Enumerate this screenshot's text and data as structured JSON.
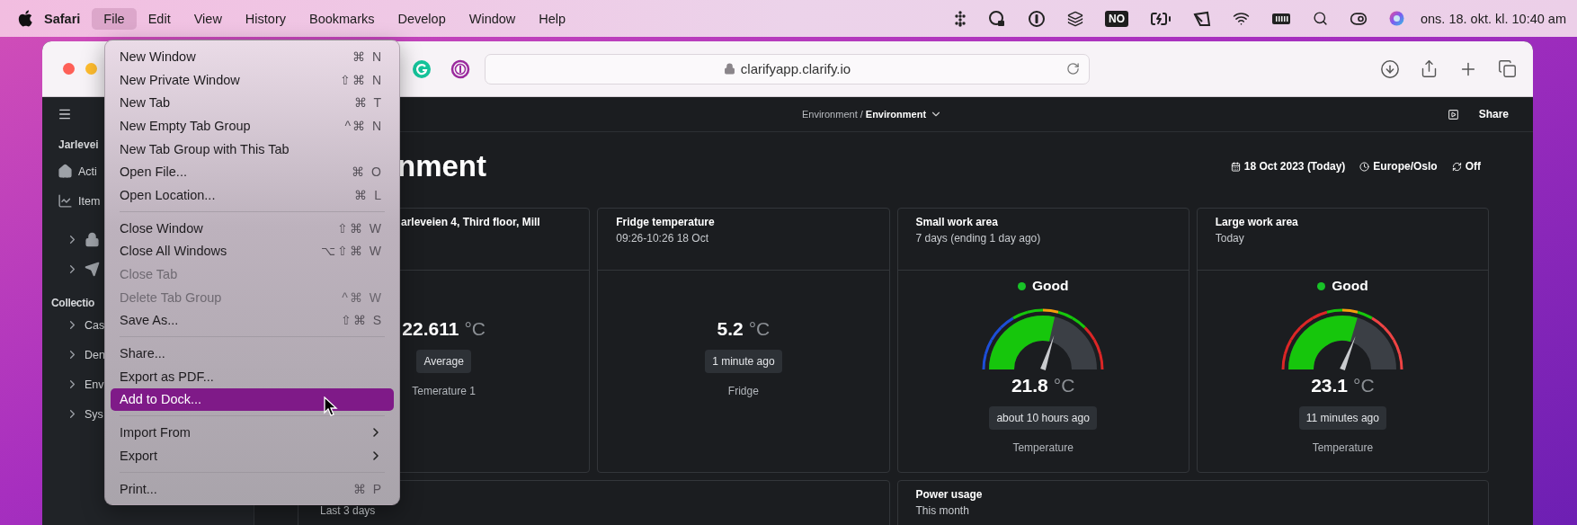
{
  "menubar": {
    "app": "Safari",
    "menus": [
      {
        "label": "File",
        "selected": true
      },
      {
        "label": "Edit",
        "selected": false
      },
      {
        "label": "View",
        "selected": false
      },
      {
        "label": "History",
        "selected": false
      },
      {
        "label": "Bookmarks",
        "selected": false
      },
      {
        "label": "Develop",
        "selected": false
      },
      {
        "label": "Window",
        "selected": false
      },
      {
        "label": "Help",
        "selected": false
      }
    ],
    "input_source": "NO",
    "clock": "ons. 18. okt. kl. 10:40 am"
  },
  "browser": {
    "url": "clarifyapp.clarify.io"
  },
  "sidebar": {
    "org": "Jarlevei",
    "nav": [
      {
        "label": "Acti"
      },
      {
        "label": "Item"
      }
    ],
    "pinned": [
      {
        "expanded": false
      },
      {
        "expanded": false
      }
    ],
    "section": "Collectio",
    "collections": [
      {
        "label": "Cas",
        "expanded": false
      },
      {
        "label": "Den",
        "expanded": false
      },
      {
        "label": "Env",
        "expanded": false
      },
      {
        "label": "Sys",
        "expanded": false
      }
    ]
  },
  "page": {
    "breadcrumb": {
      "parent": "Environment /",
      "current": "Environment"
    },
    "share": "Share",
    "title": "nment",
    "date": "18 Oct 2023 (Today)",
    "timezone": "Europe/Oslo",
    "refresh": "Off",
    "cards": [
      {
        "kind": "value",
        "title": "arleveien 4, Third floor, Mill",
        "value": "22.611",
        "unit": "°C",
        "tag": "Average",
        "caption": "Temerature 1"
      },
      {
        "kind": "value",
        "title": "Fridge temperature",
        "subtitle": "09:26-10:26 18 Oct",
        "value": "5.2",
        "unit": "°C",
        "tag": "1 minute ago",
        "caption": "Fridge"
      },
      {
        "kind": "gauge",
        "title": "Small work area",
        "subtitle": "7 days (ending 1 day ago)",
        "status": {
          "label": "Good",
          "color": "#18c227"
        },
        "gauge": {
          "level": 0.6,
          "zones": [
            {
              "color": "#1d4ed8"
            },
            {
              "color": "#1d4ed8"
            },
            {
              "color": "#1d4ed8"
            },
            {
              "color": "#1d4ed8"
            },
            {
              "color": "#16c60c"
            },
            {
              "color": "#16c60c"
            },
            {
              "color": "#f59e0b"
            },
            {
              "color": "#16c60c"
            },
            {
              "color": "#16c60c"
            },
            {
              "color": "#dc2626"
            },
            {
              "color": "#dc2626"
            },
            {
              "color": "#dc2626"
            }
          ]
        },
        "value": "21.8",
        "unit": "°C",
        "tag": "about 10 hours ago",
        "caption": "Temperature"
      },
      {
        "kind": "gauge",
        "title": "Large work area",
        "subtitle": "Today",
        "status": {
          "label": "Good",
          "color": "#18c227"
        },
        "gauge": {
          "level": 0.62,
          "zones": [
            {
              "color": "#dc2626"
            },
            {
              "color": "#dc2626"
            },
            {
              "color": "#dc2626"
            },
            {
              "color": "#dc2626"
            },
            {
              "color": "#dc2626"
            },
            {
              "color": "#16c60c"
            },
            {
              "color": "#f59e0b"
            },
            {
              "color": "#16c60c"
            },
            {
              "color": "#ef4444"
            },
            {
              "color": "#ef4444"
            },
            {
              "color": "#ef4444"
            },
            {
              "color": "#ef4444"
            }
          ]
        },
        "value": "23.1",
        "unit": "°C",
        "tag": "11 minutes ago",
        "caption": "Temperature"
      }
    ],
    "bottom_cards": [
      {
        "subtitle": "Last 3 days"
      },
      {
        "title": "Power usage",
        "subtitle": "This month"
      }
    ]
  },
  "file_menu": {
    "groups": [
      [
        {
          "label": "New Window",
          "shortcut": "⌘ N",
          "disabled": false,
          "selected": false,
          "submenu": false
        },
        {
          "label": "New Private Window",
          "shortcut": "⇧⌘ N",
          "disabled": false,
          "selected": false,
          "submenu": false
        },
        {
          "label": "New Tab",
          "shortcut": "⌘ T",
          "disabled": false,
          "selected": false,
          "submenu": false
        },
        {
          "label": "New Empty Tab Group",
          "shortcut": "^⌘ N",
          "disabled": false,
          "selected": false,
          "submenu": false
        },
        {
          "label": "New Tab Group with This Tab",
          "disabled": false,
          "selected": false,
          "submenu": false
        },
        {
          "label": "Open File...",
          "shortcut": "⌘ O",
          "disabled": false,
          "selected": false,
          "submenu": false
        },
        {
          "label": "Open Location...",
          "shortcut": "⌘ L",
          "disabled": false,
          "selected": false,
          "submenu": false
        }
      ],
      [
        {
          "label": "Close Window",
          "shortcut": "⇧⌘ W",
          "disabled": false,
          "selected": false,
          "submenu": false
        },
        {
          "label": "Close All Windows",
          "shortcut": "⌥⇧⌘ W",
          "disabled": false,
          "selected": false,
          "submenu": false
        },
        {
          "label": "Close Tab",
          "disabled": true,
          "selected": false,
          "submenu": false
        },
        {
          "label": "Delete Tab Group",
          "shortcut": "^⌘ W",
          "disabled": true,
          "selected": false,
          "submenu": false
        },
        {
          "label": "Save As...",
          "shortcut": "⇧⌘ S",
          "disabled": false,
          "selected": false,
          "submenu": false
        }
      ],
      [
        {
          "label": "Share...",
          "disabled": false,
          "selected": false,
          "submenu": false
        },
        {
          "label": "Export as PDF...",
          "disabled": false,
          "selected": false,
          "submenu": false
        },
        {
          "label": "Add to Dock...",
          "disabled": false,
          "selected": true,
          "submenu": false
        }
      ],
      [
        {
          "label": "Import From",
          "disabled": false,
          "selected": false,
          "submenu": true
        },
        {
          "label": "Export",
          "disabled": false,
          "selected": false,
          "submenu": true
        }
      ],
      [
        {
          "label": "Print...",
          "shortcut": "⌘ P",
          "disabled": false,
          "selected": false,
          "submenu": false
        }
      ]
    ]
  }
}
